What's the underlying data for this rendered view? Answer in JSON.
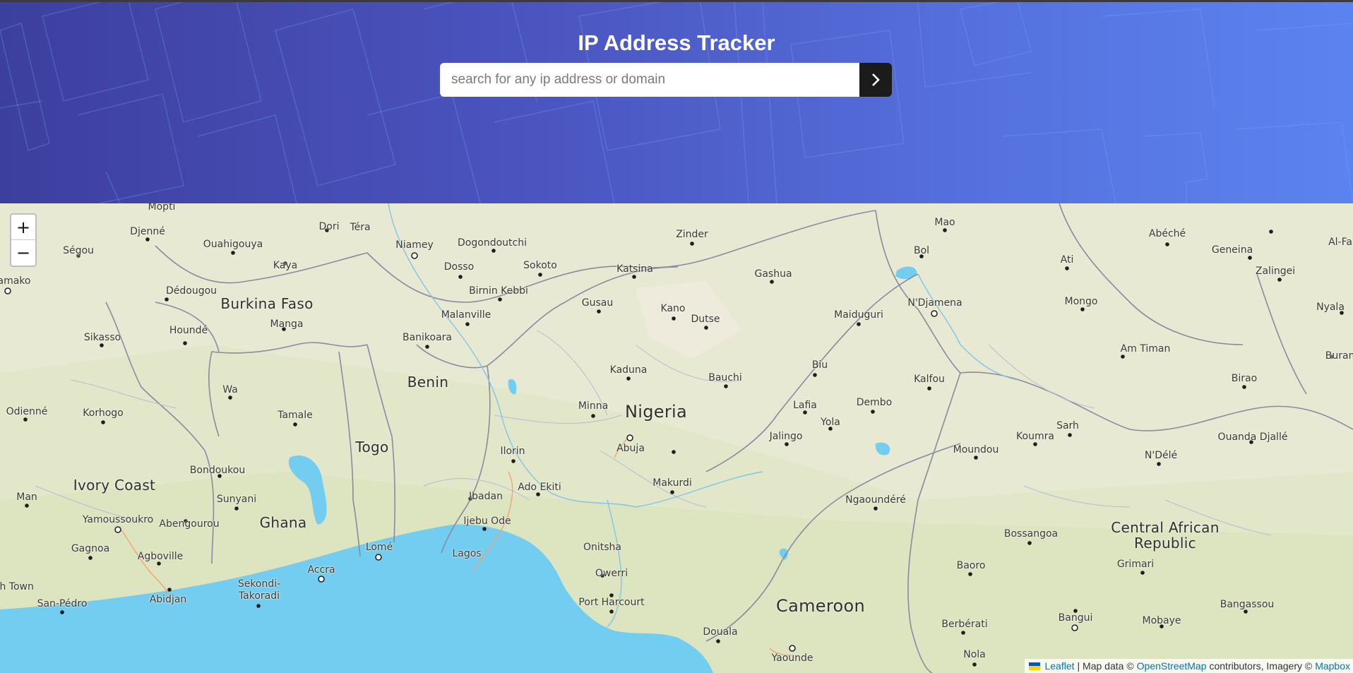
{
  "header": {
    "title": "IP Address Tracker",
    "search_placeholder": "search for any ip address or domain",
    "search_value": "",
    "submit_icon": "chevron-right-icon"
  },
  "map": {
    "zoom_in_label": "+",
    "zoom_out_label": "−",
    "attribution": {
      "leaflet": "Leaflet",
      "sep1": "| Map data ©",
      "osm": "OpenStreetMap",
      "contrib": "contributors, Imagery ©",
      "mapbox": "Mapbox"
    },
    "country_labels": [
      "Burkina Faso",
      "Benin",
      "Togo",
      "Ivory Coast",
      "Ghana",
      "Nigeria",
      "Cameroon",
      "Central African Republic"
    ],
    "city_labels": [
      "Mopti",
      "Ségou",
      "Djenné",
      "Ouahigouya",
      "Dori",
      "Téra",
      "Niamey",
      "Dogondoutchi",
      "Zinder",
      "Mao",
      "Abéché",
      "Al-Fa",
      "amako",
      "Kaya",
      "Dosso",
      "Sokoto",
      "Katsina",
      "Gashua",
      "Bol",
      "Ati",
      "Geneina",
      "Zalingei",
      "Dédougou",
      "Birnin Kebbi",
      "Gusau",
      "Kano",
      "Maiduguri",
      "N'Djamena",
      "Mongo",
      "Nyala",
      "Manga",
      "Malanville",
      "Dutse",
      "Sikasso",
      "Houndé",
      "Banikoara",
      "Am Timan",
      "Buram",
      "Kaduna",
      "Bauchi",
      "Biu",
      "Kalfou",
      "Birao",
      "Wa",
      "Odienné",
      "Korhogo",
      "Tamale",
      "Minna",
      "Lafia",
      "Dembo",
      "Yola",
      "Sarh",
      "Abuja",
      "Jalingo",
      "Koumra",
      "Ilorin",
      "Moundou",
      "Ouanda Djallé",
      "N'Délé",
      "Bondoukou",
      "Man",
      "Sunyani",
      "Ibadan",
      "Ado Ekiti",
      "Makurdi",
      "Ngaoundéré",
      "Yamoussoukro",
      "Abengourou",
      "Ijebu Ode",
      "Lomé",
      "Bossangoa",
      "Gagnoa",
      "Agboville",
      "Lagos",
      "Onitsha",
      "Baoro",
      "Grimari",
      "Accra",
      "Owerri",
      "sh Town",
      "Sekondi-Takoradi",
      "Abidjan",
      "San-Pédro",
      "Port Harcourt",
      "Bangui",
      "Bangassou",
      "Berbérati",
      "Mobaye",
      "Douala",
      "Nola",
      "Yaounde"
    ]
  }
}
